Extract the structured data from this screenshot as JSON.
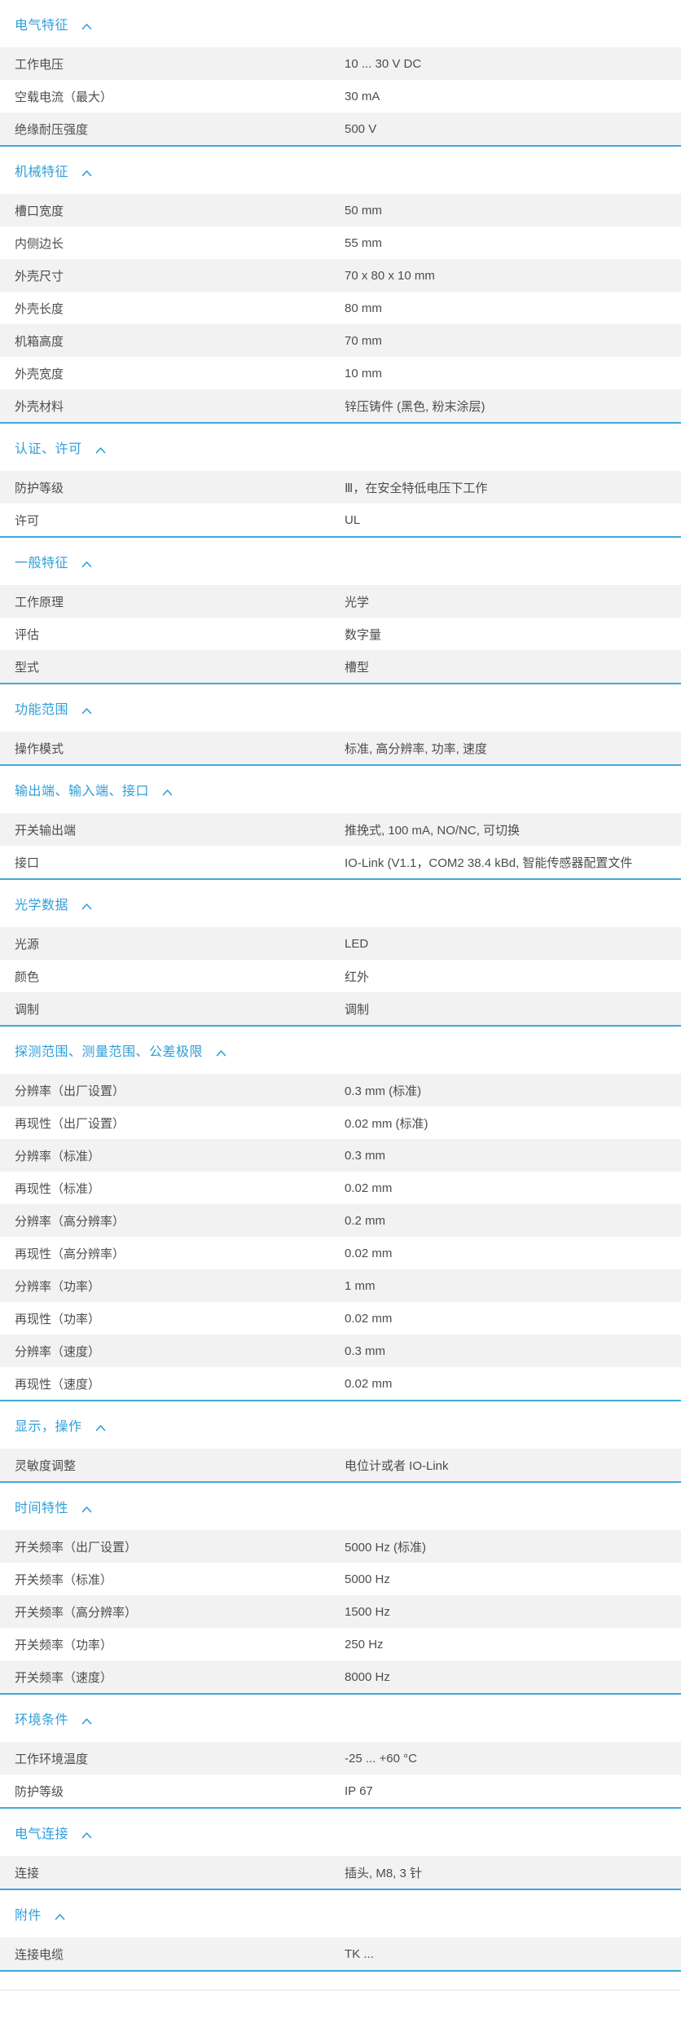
{
  "theme": {
    "accent_blue": "#2f9ed9",
    "section_border_blue": "#3fa9dc",
    "row_alt_bg": "#f2f2f2",
    "text_color": "#4d4d4d"
  },
  "icons": {
    "section_collapse": "chevron-up-icon"
  },
  "sections": [
    {
      "title": "电气特征",
      "rows": [
        {
          "label": "工作电压",
          "value": "10 ... 30 V DC"
        },
        {
          "label": "空载电流（最大）",
          "value": "30 mA"
        },
        {
          "label": "绝缘耐压强度",
          "value": "500 V"
        }
      ]
    },
    {
      "title": "机械特征",
      "rows": [
        {
          "label": "槽口宽度",
          "value": "50 mm"
        },
        {
          "label": "内侧边长",
          "value": "55 mm"
        },
        {
          "label": "外壳尺寸",
          "value": "70 x 80 x 10 mm"
        },
        {
          "label": "外壳长度",
          "value": "80 mm"
        },
        {
          "label": "机箱高度",
          "value": "70 mm"
        },
        {
          "label": "外壳宽度",
          "value": "10 mm"
        },
        {
          "label": "外壳材料",
          "value": "锌压铸件 (黑色, 粉末涂层)"
        }
      ]
    },
    {
      "title": "认证、许可",
      "rows": [
        {
          "label": "防护等级",
          "value": "Ⅲ，在安全特低电压下工作"
        },
        {
          "label": "许可",
          "value": "UL"
        }
      ]
    },
    {
      "title": "一般特征",
      "rows": [
        {
          "label": "工作原理",
          "value": "光学"
        },
        {
          "label": "评估",
          "value": "数字量"
        },
        {
          "label": "型式",
          "value": "槽型"
        }
      ]
    },
    {
      "title": "功能范围",
      "rows": [
        {
          "label": "操作模式",
          "value": "标准, 高分辨率, 功率, 速度"
        }
      ]
    },
    {
      "title": "输出端、输入端、接口",
      "rows": [
        {
          "label": "开关输出端",
          "value": "推挽式, 100 mA, NO/NC, 可切换"
        },
        {
          "label": "接口",
          "value": "IO-Link (V1.1，COM2 38.4 kBd, 智能传感器配置文件"
        }
      ]
    },
    {
      "title": "光学数据",
      "rows": [
        {
          "label": "光源",
          "value": "LED"
        },
        {
          "label": "颜色",
          "value": "红外"
        },
        {
          "label": "调制",
          "value": "调制"
        }
      ]
    },
    {
      "title": "探测范围、测量范围、公差极限",
      "rows": [
        {
          "label": "分辨率（出厂设置）",
          "value": "0.3 mm (标准)"
        },
        {
          "label": "再现性（出厂设置）",
          "value": "0.02 mm (标准)"
        },
        {
          "label": "分辨率（标准）",
          "value": "0.3 mm"
        },
        {
          "label": "再现性（标准）",
          "value": "0.02 mm"
        },
        {
          "label": "分辨率（高分辨率）",
          "value": "0.2 mm"
        },
        {
          "label": "再现性（高分辨率）",
          "value": "0.02 mm"
        },
        {
          "label": "分辨率（功率）",
          "value": "1 mm"
        },
        {
          "label": "再现性（功率）",
          "value": "0.02 mm"
        },
        {
          "label": "分辨率（速度）",
          "value": "0.3 mm"
        },
        {
          "label": "再现性（速度）",
          "value": "0.02 mm"
        }
      ]
    },
    {
      "title": "显示，操作",
      "rows": [
        {
          "label": "灵敏度调整",
          "value": "电位计或者 IO-Link"
        }
      ]
    },
    {
      "title": "时间特性",
      "rows": [
        {
          "label": "开关频率（出厂设置）",
          "value": "5000 Hz (标准)"
        },
        {
          "label": "开关频率（标准）",
          "value": "5000 Hz"
        },
        {
          "label": "开关频率（高分辨率）",
          "value": "1500 Hz"
        },
        {
          "label": "开关频率（功率）",
          "value": "250 Hz"
        },
        {
          "label": "开关频率（速度）",
          "value": "8000 Hz"
        }
      ]
    },
    {
      "title": "环境条件",
      "rows": [
        {
          "label": "工作环境温度",
          "value": "-25 ... +60 °C"
        },
        {
          "label": "防护等级",
          "value": "IP 67"
        }
      ]
    },
    {
      "title": "电气连接",
      "rows": [
        {
          "label": "连接",
          "value": "插头, M8, 3 针"
        }
      ]
    },
    {
      "title": "附件",
      "rows": [
        {
          "label": "连接电缆",
          "value": "TK ..."
        }
      ]
    }
  ]
}
